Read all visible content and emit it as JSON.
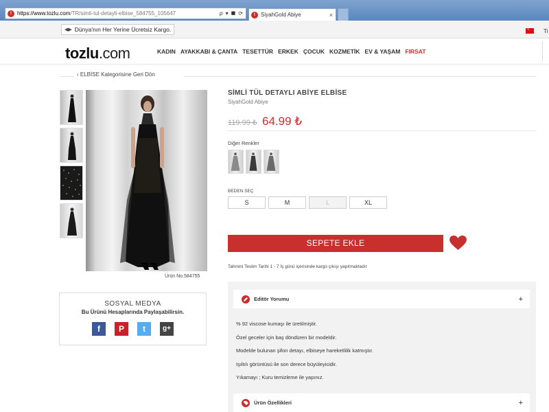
{
  "browser": {
    "url_host": "https://www.tozlu.com",
    "url_path": "/TR/simli-tul-detayli-elbise_584755_105647",
    "tab_title": "SiyahGold Abiye",
    "tab_close": "×",
    "search_tool": "ρ",
    "dropdown_tool": "▾",
    "lock_tool": "🔒",
    "refresh_tool": "⟳"
  },
  "util": {
    "shipping_text": "Dünya'nın Her Yerine Ücretsiz Kargo.",
    "country_label": "Ti"
  },
  "header": {
    "logo_main": "tozlu",
    "logo_suffix": ".com",
    "nav": [
      "KADIN",
      "AYAKKABI & ÇANTA",
      "TESETTÜR",
      "ERKEK",
      "ÇOCUK",
      "KOZMETİK",
      "EV & YAŞAM",
      "FIRSAT"
    ]
  },
  "back_link": "‹  ELBİSE Kategorisine Geri Dön",
  "product": {
    "title": "SİMLİ TÜL DETAYLI ABİYE ELBİSE",
    "subtitle": "SiyahGold Abiye",
    "old_price": "119.99 ₺",
    "new_price": "64.99 ₺",
    "product_no": "Ürün No.584755",
    "colors_label": "Diğer Renkler",
    "size_label": "BEDEN SEÇ",
    "sizes": [
      {
        "label": "S",
        "available": true
      },
      {
        "label": "M",
        "available": true
      },
      {
        "label": "L",
        "available": false
      },
      {
        "label": "XL",
        "available": true
      }
    ],
    "add_to_cart": "SEPETE EKLE",
    "delivery": "Tahmini Teslim Tarihi 1 - 7 İş günü içerisinde kargo çıkışı yapılmaktadır"
  },
  "social": {
    "title": "SOSYAL MEDYA",
    "subtitle": "Bu Ürünü Hesaplarında Paylaşabilirsin.",
    "icons": [
      {
        "name": "facebook",
        "glyph": "f",
        "color": "#3b5998"
      },
      {
        "name": "pinterest",
        "glyph": "P",
        "color": "#cb2027"
      },
      {
        "name": "twitter",
        "glyph": "t",
        "color": "#55acee"
      },
      {
        "name": "googleplus",
        "glyph": "g+",
        "color": "#444444"
      }
    ]
  },
  "accordion": {
    "editor_label": "Editör Yorumu",
    "features_label": "Ürün Özellikleri",
    "plus": "+",
    "editor_lines": [
      "% 92 viscose kumaşı ile üretilmiştir.",
      "Özel geceler için baş döndüren bir modeldir.",
      "Modelde bulunan şifon detayı, elbiseye hareketlilik katmıştır.",
      "Işıltılı görüntüsü ile son derece büyüleyicidir.",
      "Yıkamayı ; Kuru temizleme ile yapınız."
    ]
  },
  "colors": {
    "brand_red": "#c8302e"
  }
}
